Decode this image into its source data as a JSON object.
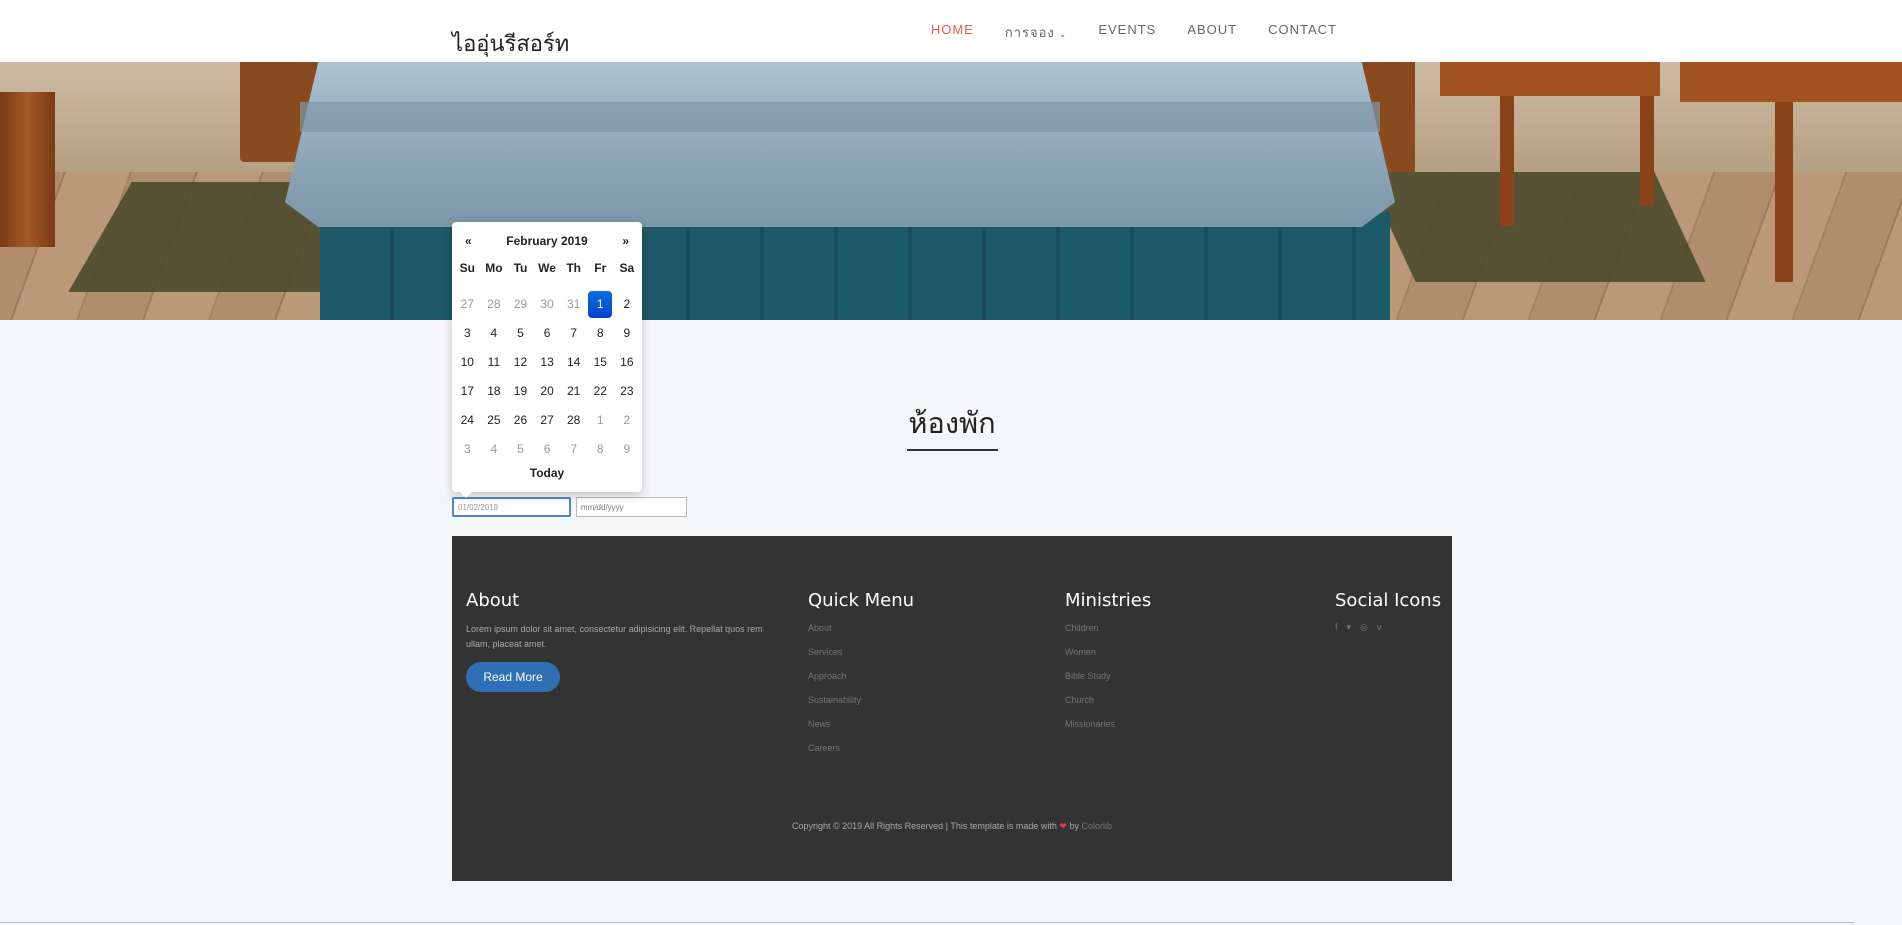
{
  "nav": {
    "brand": "ไออุ่นรีสอร์ท",
    "items": [
      "HOME",
      "การจอง",
      "EVENTS",
      "ABOUT",
      "CONTACT"
    ],
    "active_color": "#e8594a"
  },
  "section": {
    "title": "ห้องพัก"
  },
  "booking": {
    "checkin_value": "01/02/2019",
    "checkout_placeholder": "mm/dd/yyyy"
  },
  "datepicker": {
    "prev": "«",
    "next": "»",
    "month": "February 2019",
    "weekdays": [
      "Su",
      "Mo",
      "Tu",
      "We",
      "Th",
      "Fr",
      "Sa"
    ],
    "days": [
      [
        "27",
        "28",
        "29",
        "30",
        "31",
        "1",
        "2"
      ],
      [
        "3",
        "4",
        "5",
        "6",
        "7",
        "8",
        "9"
      ],
      [
        "10",
        "11",
        "12",
        "13",
        "14",
        "15",
        "16"
      ],
      [
        "17",
        "18",
        "19",
        "20",
        "21",
        "22",
        "23"
      ],
      [
        "24",
        "25",
        "26",
        "27",
        "28",
        "1",
        "2"
      ],
      [
        "3",
        "4",
        "5",
        "6",
        "7",
        "8",
        "9"
      ]
    ],
    "selected": "1",
    "today_label": "Today",
    "selected_color": "#0044cc"
  },
  "footer": {
    "about_heading": "About",
    "about_text": "Lorem ipsum dolor sit amet, consectetur adipisicing elit. Repellat quos rem ullam, placeat amet.",
    "read_more": "Read More",
    "quick_heading": "Quick Menu",
    "quick_links": [
      "About",
      "Services",
      "Approach",
      "Sustainability",
      "News",
      "Careers"
    ],
    "ministries_heading": "Ministries",
    "ministries_links": [
      "Children",
      "Women",
      "Bible Study",
      "Church",
      "Missionaries"
    ],
    "social_heading": "Social Icons",
    "social_icons": [
      "facebook-icon",
      "twitter-icon",
      "instagram-icon",
      "vimeo-icon"
    ],
    "copyright_before": "Copyright © 2019 All Rights Reserved | This template is made with",
    "copyright_by": "by",
    "copyright_link": "Colorlib"
  }
}
